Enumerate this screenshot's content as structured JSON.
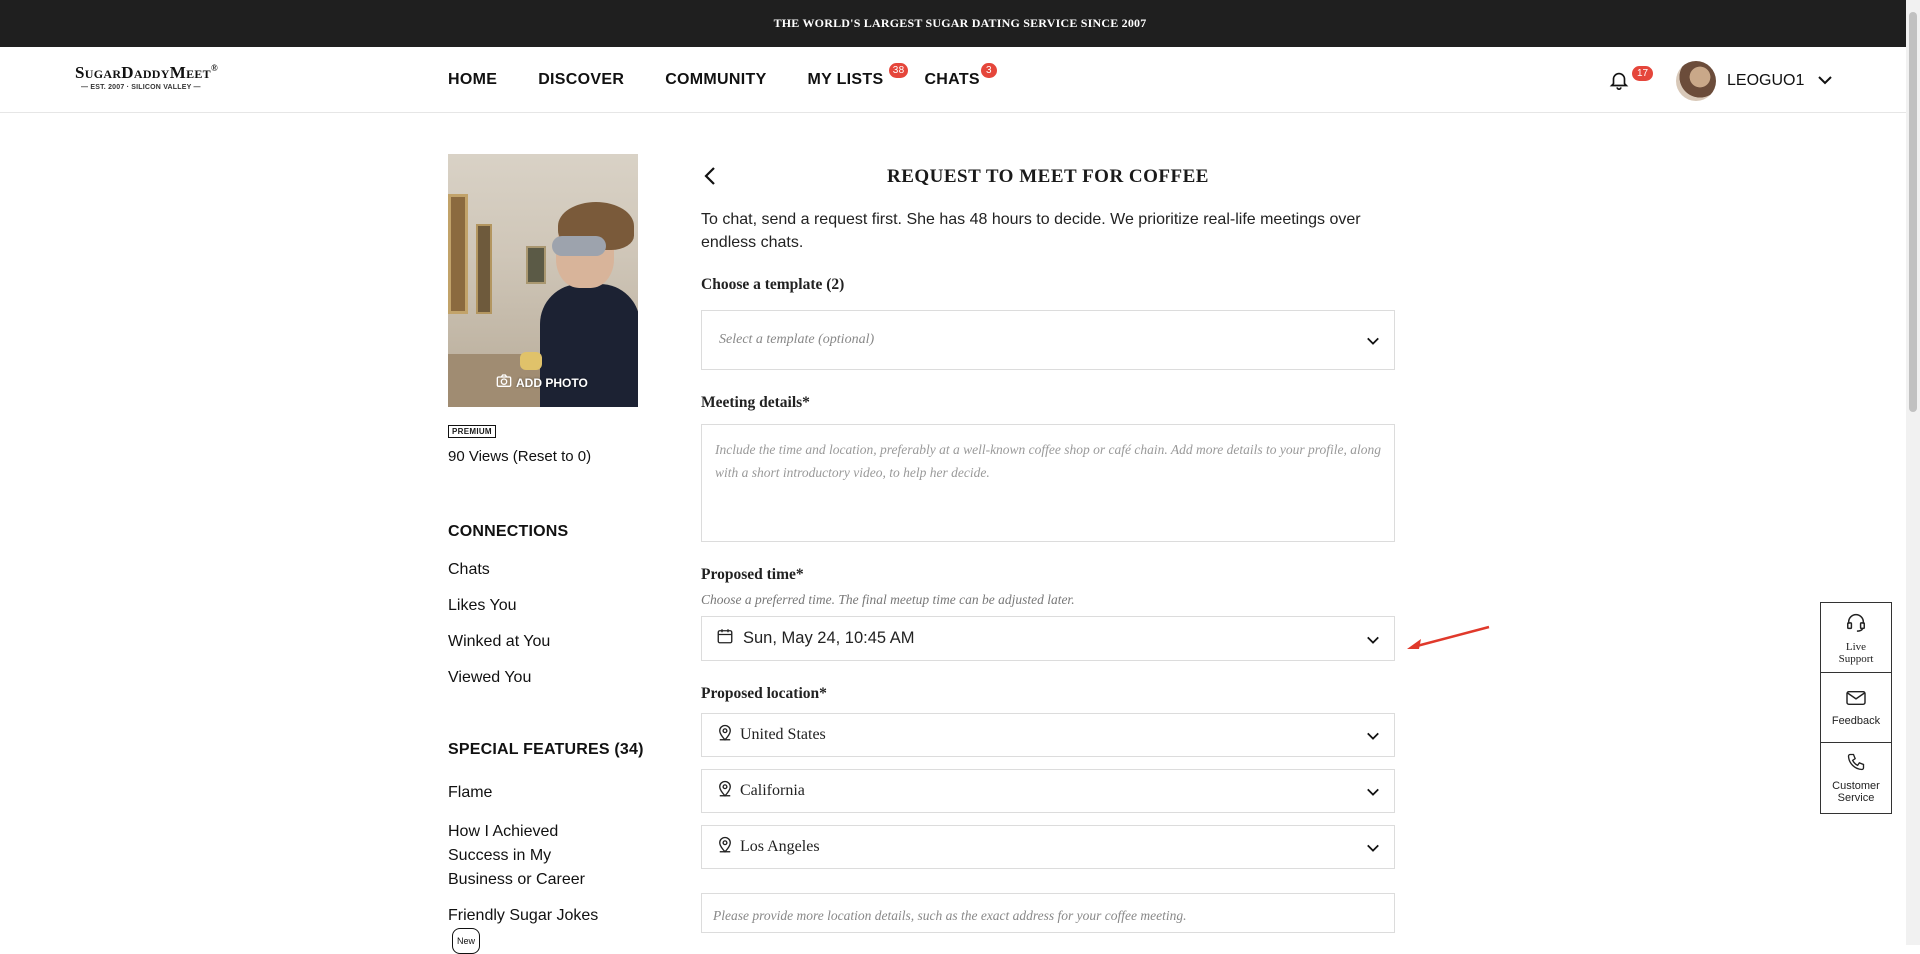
{
  "topbar": {
    "text": "THE WORLD'S LARGEST SUGAR DATING SERVICE SINCE 2007"
  },
  "logo": {
    "name": "SugarDaddyMeet",
    "reg": "®",
    "tagline": "— EST. 2007 · SILICON VALLEY —"
  },
  "nav": {
    "items": [
      {
        "label": "HOME"
      },
      {
        "label": "DISCOVER"
      },
      {
        "label": "COMMUNITY"
      },
      {
        "label": "MY LISTS",
        "badge": "38"
      },
      {
        "label": "CHATS",
        "badge": "3"
      }
    ]
  },
  "header": {
    "notifications": "17",
    "username": "LEOGUO1"
  },
  "sidebar": {
    "add_photo": "ADD PHOTO",
    "premium": "PREMIUM",
    "views": "90 Views (Reset to 0)",
    "connections_heading": "CONNECTIONS",
    "connections": [
      "Chats",
      "Likes You",
      "Winked at You",
      "Viewed You"
    ],
    "special_heading": "SPECIAL FEATURES (34)",
    "special": [
      "Flame",
      "How I Achieved Success in My Business or Career",
      "Friendly Sugar Jokes"
    ],
    "new_badge": "New"
  },
  "main": {
    "title": "REQUEST TO MEET FOR COFFEE",
    "intro": "To chat, send a request first. She has 48 hours to decide. We prioritize real-life meetings over endless chats.",
    "template_label": "Choose a template (2)",
    "template_placeholder": "Select a template (optional)",
    "meeting_label": "Meeting details*",
    "meeting_placeholder": "Include the time and location, preferably at a well-known coffee shop or café chain. Add more details to your profile, along with a short introductory video, to help her decide.",
    "time_label": "Proposed time*",
    "time_hint": "Choose a preferred time. The final meetup time can be adjusted later.",
    "time_value": "Sun, May 24, 10:45 AM",
    "location_label": "Proposed location*",
    "country": "United States",
    "state": "California",
    "city": "Los Angeles",
    "location_details_placeholder": "Please provide more location details, such as the exact address for your coffee meeting."
  },
  "support": {
    "live": "Live Support",
    "feedback": "Feedback",
    "customer": "Customer Service"
  },
  "colors": {
    "accent_red": "#e5463b",
    "topbar": "#1f1f1f",
    "annotation_arrow": "#e0392b"
  }
}
